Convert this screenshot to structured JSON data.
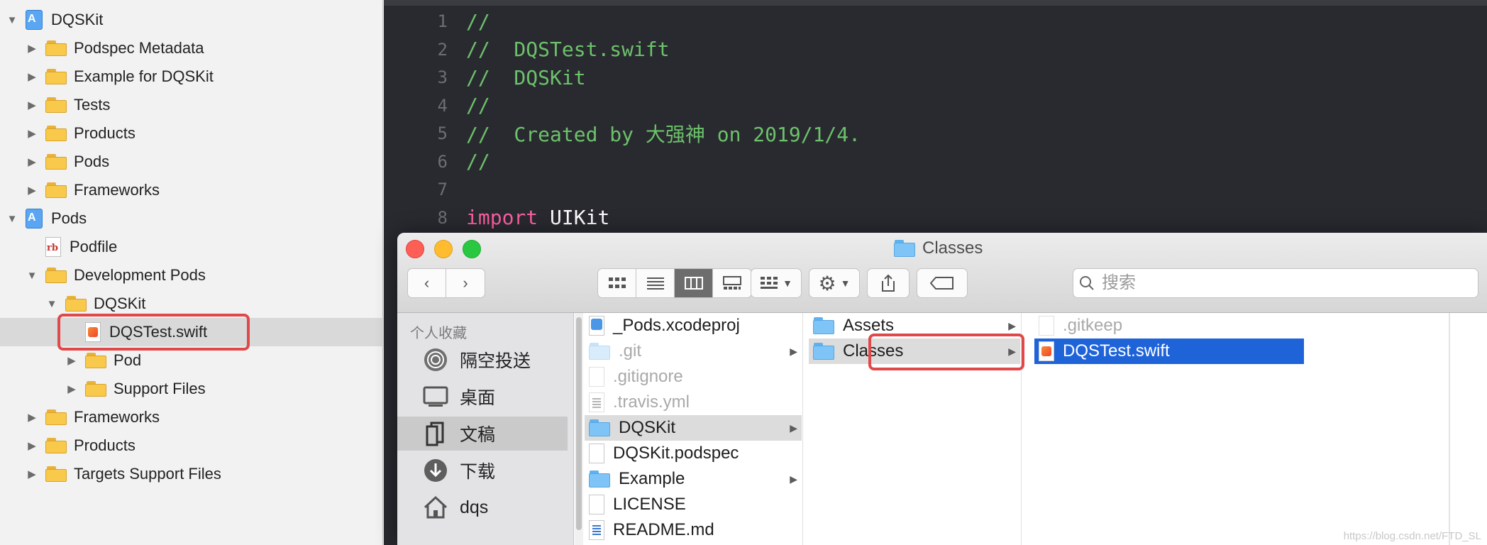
{
  "navigator": {
    "rows": [
      {
        "label": "DQSKit",
        "icon": "project-icon",
        "disclosure": "open"
      },
      {
        "label": "Podspec Metadata",
        "icon": "folder-icon",
        "disclosure": "closed"
      },
      {
        "label": "Example for DQSKit",
        "icon": "folder-icon",
        "disclosure": "closed"
      },
      {
        "label": "Tests",
        "icon": "folder-icon",
        "disclosure": "closed"
      },
      {
        "label": "Products",
        "icon": "folder-icon",
        "disclosure": "closed"
      },
      {
        "label": "Pods",
        "icon": "folder-icon",
        "disclosure": "closed"
      },
      {
        "label": "Frameworks",
        "icon": "folder-icon",
        "disclosure": "closed"
      },
      {
        "label": "Pods",
        "icon": "project-icon",
        "disclosure": "open"
      },
      {
        "label": "Podfile",
        "icon": "ruby-file-icon",
        "disclosure": "none"
      },
      {
        "label": "Development Pods",
        "icon": "folder-icon",
        "disclosure": "open"
      },
      {
        "label": "DQSKit",
        "icon": "folder-icon",
        "disclosure": "open"
      },
      {
        "label": "DQSTest.swift",
        "icon": "swift-file-icon",
        "disclosure": "none",
        "selected": true
      },
      {
        "label": "Pod",
        "icon": "folder-icon",
        "disclosure": "closed"
      },
      {
        "label": "Support Files",
        "icon": "folder-icon",
        "disclosure": "closed"
      },
      {
        "label": "Frameworks",
        "icon": "folder-icon",
        "disclosure": "closed"
      },
      {
        "label": "Products",
        "icon": "folder-icon",
        "disclosure": "closed"
      },
      {
        "label": "Targets Support Files",
        "icon": "folder-icon",
        "disclosure": "closed"
      }
    ]
  },
  "editor": {
    "lines": [
      {
        "num": "1",
        "text": "//",
        "kind": "comment"
      },
      {
        "num": "2",
        "text": "//  DQSTest.swift",
        "kind": "comment"
      },
      {
        "num": "3",
        "text": "//  DQSKit",
        "kind": "comment"
      },
      {
        "num": "4",
        "text": "//",
        "kind": "comment"
      },
      {
        "num": "5",
        "text": "//  Created by 大强神 on 2019/1/4.",
        "kind": "comment"
      },
      {
        "num": "6",
        "text": "//",
        "kind": "comment"
      },
      {
        "num": "7",
        "text": "",
        "kind": "plain"
      },
      {
        "num": "8",
        "keyword": "import",
        "text": " UIKit",
        "kind": "import"
      }
    ]
  },
  "finder": {
    "title": "Classes",
    "search_placeholder": "搜索",
    "sidebar": {
      "heading": "个人收藏",
      "items": [
        {
          "label": "隔空投送",
          "icon": "airdrop-icon"
        },
        {
          "label": "桌面",
          "icon": "desktop-icon"
        },
        {
          "label": "文稿",
          "icon": "documents-icon",
          "active": true
        },
        {
          "label": "下载",
          "icon": "downloads-icon"
        },
        {
          "label": "dqs",
          "icon": "home-icon"
        }
      ]
    },
    "columns": [
      {
        "items": [
          {
            "label": "_Pods.xcodeproj",
            "icon": "xcodeproj-icon"
          },
          {
            "label": ".git",
            "icon": "folder-icon",
            "dim": true,
            "arrow": true
          },
          {
            "label": ".gitignore",
            "icon": "file-icon",
            "dim": true
          },
          {
            "label": ".travis.yml",
            "icon": "text-file-icon",
            "dim": true
          },
          {
            "label": "DQSKit",
            "icon": "folder-icon",
            "arrow": true,
            "selected": "gray"
          },
          {
            "label": "DQSKit.podspec",
            "icon": "file-icon"
          },
          {
            "label": "Example",
            "icon": "folder-icon",
            "arrow": true
          },
          {
            "label": "LICENSE",
            "icon": "file-icon"
          },
          {
            "label": "README.md",
            "icon": "markdown-file-icon"
          }
        ]
      },
      {
        "items": [
          {
            "label": "Assets",
            "icon": "folder-icon",
            "arrow": true
          },
          {
            "label": "Classes",
            "icon": "folder-icon",
            "arrow": true,
            "selected": "gray"
          }
        ]
      },
      {
        "items": [
          {
            "label": ".gitkeep",
            "icon": "file-icon",
            "dim": true
          },
          {
            "label": "DQSTest.swift",
            "icon": "swift-file-icon",
            "selected": "blue"
          }
        ]
      }
    ]
  },
  "watermark": "https://blog.csdn.net/FTD_SL",
  "colors": {
    "highlight_box": "#e0484a",
    "selection_blue": "#1f63d9",
    "comment_green": "#6cc26a",
    "keyword_pink": "#fc5fa3",
    "editor_bg": "#292a30"
  }
}
